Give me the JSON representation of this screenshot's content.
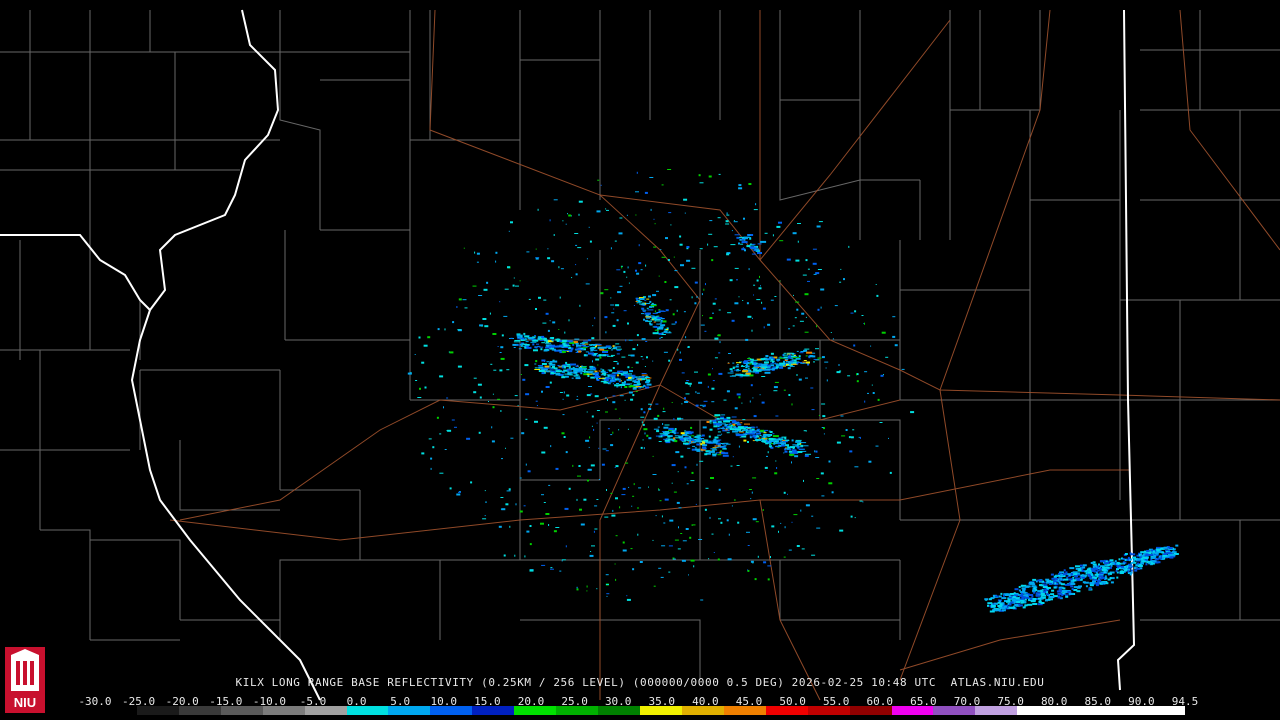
{
  "caption": "KILX LONG RANGE BASE REFLECTIVITY (0.25KM / 256 LEVEL) (000000/0000 0.5 DEG) 2026-02-25 10:48 UTC  ATLAS.NIU.EDU",
  "scale": {
    "labels": [
      "-30.0",
      "-25.0",
      "-20.0",
      "-15.0",
      "-10.0",
      "-5.0",
      "0.0",
      "5.0",
      "10.0",
      "15.0",
      "20.0",
      "25.0",
      "30.0",
      "35.0",
      "40.0",
      "45.0",
      "50.0",
      "55.0",
      "60.0",
      "65.0",
      "70.0",
      "75.0",
      "80.0",
      "85.0",
      "90.0",
      "94.5"
    ],
    "colors": [
      "#000000",
      "#1a1a1a",
      "#3a3a3a",
      "#5a5a5a",
      "#7c7c7c",
      "#a0a0a0",
      "#00e0e0",
      "#00a8f0",
      "#0060f0",
      "#0020c0",
      "#00e000",
      "#00b000",
      "#008000",
      "#f0f000",
      "#e0b000",
      "#f08000",
      "#f00000",
      "#c00000",
      "#900000",
      "#f000f0",
      "#9050c0",
      "#c0a0e0",
      "#ffffff",
      "#ffffff",
      "#ffffff",
      "#ffffff"
    ]
  },
  "logo": {
    "text": "NIU",
    "color": "#c8102e"
  }
}
